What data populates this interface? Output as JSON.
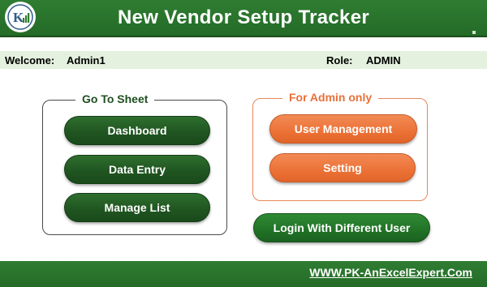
{
  "header": {
    "title": "New Vendor Setup Tracker",
    "logo_icon": "pk-logo-icon"
  },
  "welcome_bar": {
    "welcome_label": "Welcome:",
    "user_name": "Admin1",
    "role_label": "Role:",
    "role_value": "ADMIN"
  },
  "go_to_sheet": {
    "title": "Go To Sheet",
    "buttons": [
      "Dashboard",
      "Data Entry",
      "Manage List"
    ]
  },
  "admin_only": {
    "title": "For Admin only",
    "buttons": [
      "User Management",
      "Setting"
    ]
  },
  "login_button": "Login With Different User",
  "footer": {
    "website": "WWW.PK-AnExcelExpert.Com"
  },
  "colors": {
    "header_green": "#2f7d32",
    "button_green": "#1f5420",
    "admin_orange": "#ea6e32",
    "welcome_bg": "#e3f1de"
  }
}
